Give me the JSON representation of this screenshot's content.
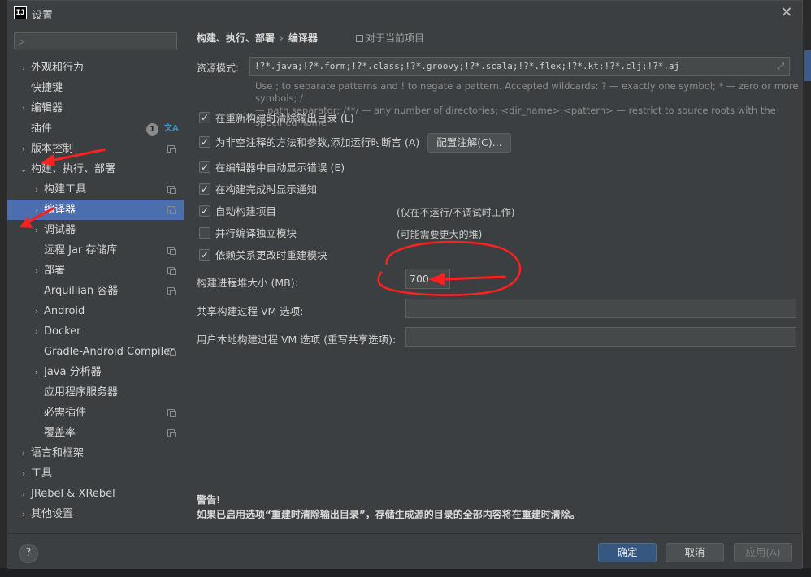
{
  "window": {
    "title": "设置",
    "app_icon_text": "IJ",
    "close_icon": "close-icon"
  },
  "sidebar": {
    "search_placeholder": "",
    "items": [
      {
        "label": "外观和行为",
        "level": 0,
        "arrow": "›"
      },
      {
        "label": "快捷键",
        "level": 0,
        "arrow": ""
      },
      {
        "label": "编辑器",
        "level": 0,
        "arrow": "›"
      },
      {
        "label": "插件",
        "level": 0,
        "arrow": "",
        "badge": "1"
      },
      {
        "label": "版本控制",
        "level": 0,
        "arrow": "›",
        "copy": true
      },
      {
        "label": "构建、执行、部署",
        "level": 0,
        "arrow": "⌄"
      },
      {
        "label": "构建工具",
        "level": 1,
        "arrow": "›",
        "copy": true
      },
      {
        "label": "编译器",
        "level": 1,
        "arrow": "›",
        "copy": true,
        "selected": true
      },
      {
        "label": "调试器",
        "level": 1,
        "arrow": "›"
      },
      {
        "label": "远程 Jar 存储库",
        "level": 1,
        "arrow": "",
        "copy": true
      },
      {
        "label": "部署",
        "level": 1,
        "arrow": "›",
        "copy": true
      },
      {
        "label": "Arquillian 容器",
        "level": 1,
        "arrow": "",
        "copy": true
      },
      {
        "label": "Android",
        "level": 1,
        "arrow": "›"
      },
      {
        "label": "Docker",
        "level": 1,
        "arrow": "›"
      },
      {
        "label": "Gradle-Android Compiler",
        "level": 1,
        "arrow": "",
        "copy": true
      },
      {
        "label": "Java 分析器",
        "level": 1,
        "arrow": "›"
      },
      {
        "label": "应用程序服务器",
        "level": 1,
        "arrow": ""
      },
      {
        "label": "必需插件",
        "level": 1,
        "arrow": "",
        "copy": true
      },
      {
        "label": "覆盖率",
        "level": 1,
        "arrow": "",
        "copy": true
      },
      {
        "label": "语言和框架",
        "level": 0,
        "arrow": "›"
      },
      {
        "label": "工具",
        "level": 0,
        "arrow": "›"
      },
      {
        "label": "JRebel & XRebel",
        "level": 0,
        "arrow": "›"
      },
      {
        "label": "其他设置",
        "level": 0,
        "arrow": "›"
      }
    ]
  },
  "main": {
    "breadcrumb": {
      "parent": "构建、执行、部署",
      "sep": "›",
      "current": "编译器"
    },
    "scope": "对于当前项目",
    "resource_label": "资源模式:",
    "resource_value": "!?*.java;!?*.form;!?*.class;!?*.groovy;!?*.scala;!?*.flex;!?*.kt;!?*.clj;!?*.aj",
    "hint_line1": "Use ; to separate patterns and ! to negate a pattern. Accepted wildcards: ? — exactly one symbol; * — zero or more symbols; /",
    "hint_line2": "— path separator; /**/ — any number of directories; <dir_name>:<pattern> — restrict to source roots with the specified name",
    "checkboxes": [
      {
        "label": "在重新构建时清除输出目录 (L)",
        "checked": true
      },
      {
        "label": "为非空注释的方法和参数,添加运行时断言 (A)",
        "checked": true
      },
      {
        "label": "在编辑器中自动显示错误 (E)",
        "checked": true
      },
      {
        "label": "在构建完成时显示通知",
        "checked": true
      },
      {
        "label": "自动构建项目",
        "checked": true,
        "note": "(仅在不运行/不调试时工作)"
      },
      {
        "label": "并行编译独立模块",
        "checked": false,
        "note": "(可能需要更大的堆)"
      },
      {
        "label": "依赖关系更改时重建模块",
        "checked": true
      }
    ],
    "configure_annotations_button": "配置注解(C)...",
    "heap_label": "构建进程堆大小 (MB):",
    "heap_value": "700",
    "shared_vm_label": "共享构建过程 VM 选项:",
    "shared_vm_value": "",
    "user_vm_label": "用户本地构建过程 VM 选项 (重写共享选项):",
    "user_vm_value": "",
    "warning_title": "警告!",
    "warning_text": "如果已启用选项“重建时清除输出目录”，存储生成源的目录的全部内容将在重建时清除。"
  },
  "footer": {
    "help": "?",
    "ok": "确定",
    "cancel": "取消",
    "apply": "应用(A)"
  },
  "colors": {
    "accent_selected": "#4b6eaf",
    "annotation": "#ff2020"
  }
}
